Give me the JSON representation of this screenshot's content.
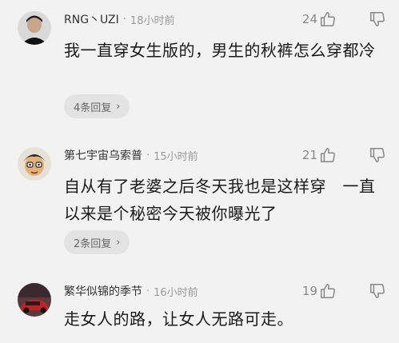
{
  "comments": [
    {
      "username": "RNG丶UZI",
      "separator": "·",
      "time": "18小时前",
      "likes": "24",
      "text": "我一直穿女生版的，男生的秋裤怎么穿都冷",
      "replies": "4条回复"
    },
    {
      "username": "第七宇宙乌索普",
      "separator": "·",
      "time": "15小时前",
      "likes": "21",
      "text": "自从有了老婆之后冬天我也是这样穿　一直以来是个秘密今天被你曝光了",
      "replies": "2条回复"
    },
    {
      "username": "繁华似锦的季节",
      "separator": "·",
      "time": "16小时前",
      "likes": "19",
      "text": "走女人的路，让女人无路可走。"
    }
  ],
  "icons": {
    "like": "thumbs-up-icon",
    "dislike": "thumbs-down-icon",
    "chevron": "chevron-right-icon"
  },
  "colors": {
    "background": "#f2f2f2",
    "pill": "#e3e3e3"
  }
}
